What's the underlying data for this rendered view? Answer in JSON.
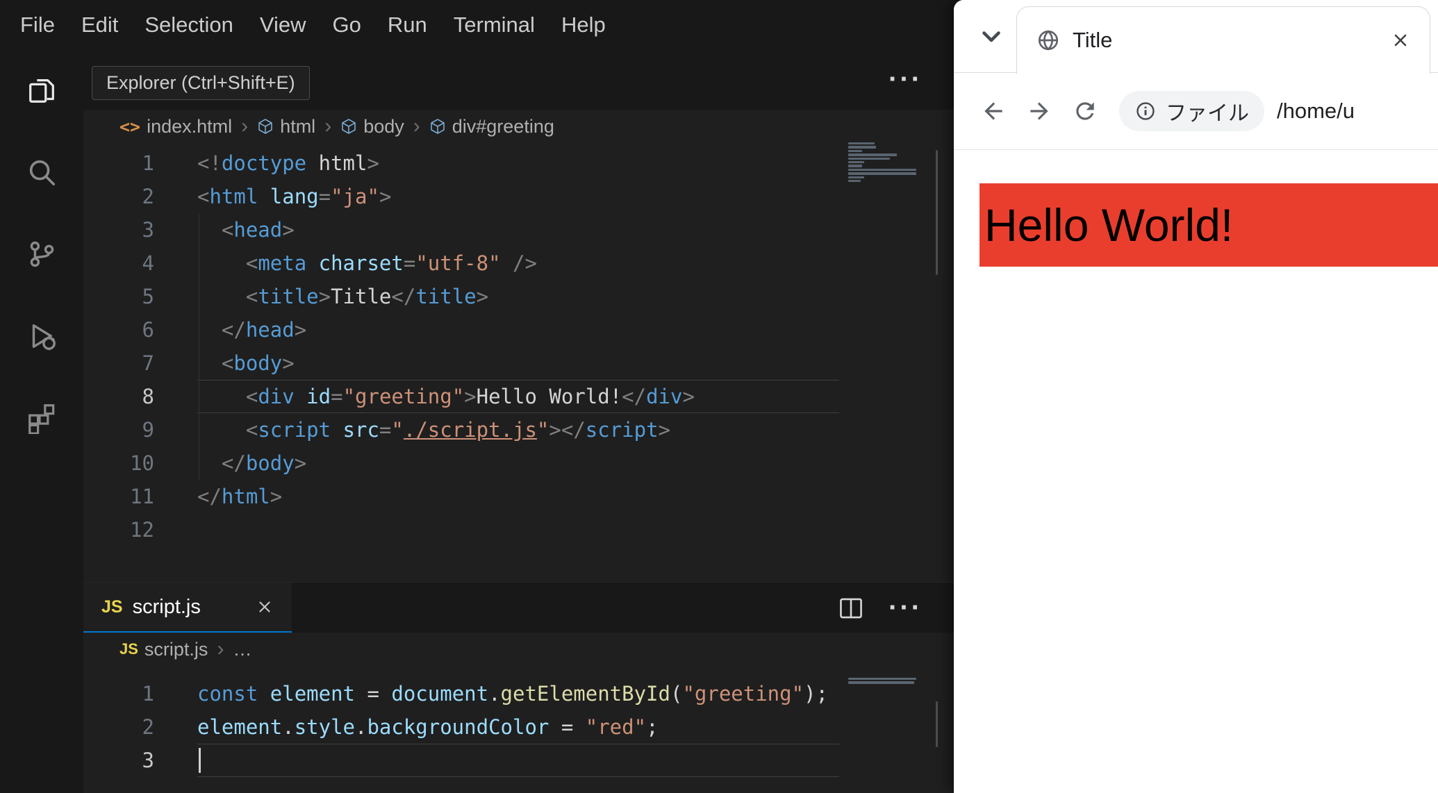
{
  "colors": {
    "accent": "#0078d4",
    "page_red": "#e93e2e",
    "editor_bg": "#1f1f1f",
    "chrome_bg": "#181818"
  },
  "icons": {
    "js_badge": "JS",
    "html_file": "<>",
    "more_actions": "···",
    "breadcrumb_separator": "›"
  },
  "vscode": {
    "menu": [
      "File",
      "Edit",
      "Selection",
      "View",
      "Go",
      "Run",
      "Terminal",
      "Help"
    ],
    "tooltip": "Explorer (Ctrl+Shift+E)",
    "activity_bar": [
      "explorer",
      "search",
      "source-control",
      "run-and-debug",
      "extensions"
    ],
    "html_editor": {
      "breadcrumbs": [
        {
          "icon": "html_file",
          "label": "index.html"
        },
        {
          "icon": "cube",
          "label": "html"
        },
        {
          "icon": "cube",
          "label": "body"
        },
        {
          "icon": "cube",
          "label": "div#greeting"
        }
      ],
      "active_line": 8,
      "lines": [
        {
          "n": "1",
          "t": [
            [
              "pn",
              "<!"
            ],
            [
              "tag",
              "doctype"
            ],
            [
              "tx",
              " html"
            ],
            [
              "pn",
              ">"
            ]
          ]
        },
        {
          "n": "2",
          "t": [
            [
              "pn",
              "<"
            ],
            [
              "tag",
              "html"
            ],
            [
              "at",
              " lang"
            ],
            [
              "pn",
              "="
            ],
            [
              "st",
              "\"ja\""
            ],
            [
              "pn",
              ">"
            ]
          ]
        },
        {
          "n": "3",
          "t": [
            [
              "tx",
              "  "
            ],
            [
              "pn",
              "<"
            ],
            [
              "tag",
              "head"
            ],
            [
              "pn",
              ">"
            ]
          ]
        },
        {
          "n": "4",
          "t": [
            [
              "tx",
              "    "
            ],
            [
              "pn",
              "<"
            ],
            [
              "tag",
              "meta"
            ],
            [
              "at",
              " charset"
            ],
            [
              "pn",
              "="
            ],
            [
              "st",
              "\"utf-8\""
            ],
            [
              "tx",
              " "
            ],
            [
              "pn",
              "/>"
            ]
          ]
        },
        {
          "n": "5",
          "t": [
            [
              "tx",
              "    "
            ],
            [
              "pn",
              "<"
            ],
            [
              "tag",
              "title"
            ],
            [
              "pn",
              ">"
            ],
            [
              "tx",
              "Title"
            ],
            [
              "pn",
              "</"
            ],
            [
              "tag",
              "title"
            ],
            [
              "pn",
              ">"
            ]
          ]
        },
        {
          "n": "6",
          "t": [
            [
              "tx",
              "  "
            ],
            [
              "pn",
              "</"
            ],
            [
              "tag",
              "head"
            ],
            [
              "pn",
              ">"
            ]
          ]
        },
        {
          "n": "7",
          "t": [
            [
              "tx",
              "  "
            ],
            [
              "pn",
              "<"
            ],
            [
              "tag",
              "body"
            ],
            [
              "pn",
              ">"
            ]
          ]
        },
        {
          "n": "8",
          "t": [
            [
              "tx",
              "    "
            ],
            [
              "pn",
              "<"
            ],
            [
              "tag",
              "div"
            ],
            [
              "at",
              " id"
            ],
            [
              "pn",
              "="
            ],
            [
              "st",
              "\"greeting\""
            ],
            [
              "pn",
              ">"
            ],
            [
              "tx",
              "Hello World!"
            ],
            [
              "pn",
              "</"
            ],
            [
              "tag",
              "div"
            ],
            [
              "pn",
              ">"
            ]
          ]
        },
        {
          "n": "9",
          "t": [
            [
              "tx",
              "    "
            ],
            [
              "pn",
              "<"
            ],
            [
              "tag",
              "script"
            ],
            [
              "at",
              " src"
            ],
            [
              "pn",
              "="
            ],
            [
              "st",
              "\""
            ],
            [
              "lk",
              "./script.js"
            ],
            [
              "st",
              "\""
            ],
            [
              "pn",
              ">"
            ],
            [
              "pn",
              "</"
            ],
            [
              "tag",
              "script"
            ],
            [
              "pn",
              ">"
            ]
          ]
        },
        {
          "n": "10",
          "t": [
            [
              "tx",
              "  "
            ],
            [
              "pn",
              "</"
            ],
            [
              "tag",
              "body"
            ],
            [
              "pn",
              ">"
            ]
          ]
        },
        {
          "n": "11",
          "t": [
            [
              "pn",
              "</"
            ],
            [
              "tag",
              "html"
            ],
            [
              "pn",
              ">"
            ]
          ]
        },
        {
          "n": "12",
          "t": []
        }
      ]
    },
    "panel": {
      "tab_label": "script.js",
      "breadcrumbs": [
        {
          "icon": "js_badge",
          "label": "script.js"
        },
        {
          "icon": null,
          "label": "…"
        }
      ],
      "active_line": 3,
      "lines": [
        {
          "n": "1",
          "t": [
            [
              "kw",
              "const"
            ],
            [
              "vr",
              " element"
            ],
            [
              "op",
              " = "
            ],
            [
              "vr",
              "document"
            ],
            [
              "op",
              "."
            ],
            [
              "fn",
              "getElementById"
            ],
            [
              "op",
              "("
            ],
            [
              "st",
              "\"greeting\""
            ],
            [
              "op",
              ")"
            ],
            [
              "op",
              ";"
            ]
          ]
        },
        {
          "n": "2",
          "t": [
            [
              "vr",
              "element"
            ],
            [
              "op",
              "."
            ],
            [
              "at",
              "style"
            ],
            [
              "op",
              "."
            ],
            [
              "at",
              "backgroundColor"
            ],
            [
              "op",
              " = "
            ],
            [
              "st",
              "\"red\""
            ],
            [
              "op",
              ";"
            ]
          ]
        },
        {
          "n": "3",
          "t": []
        }
      ]
    }
  },
  "browser": {
    "tab_title": "Title",
    "address": {
      "chip": "ファイル",
      "path": "/home/u"
    },
    "page": {
      "heading": "Hello World!"
    }
  }
}
